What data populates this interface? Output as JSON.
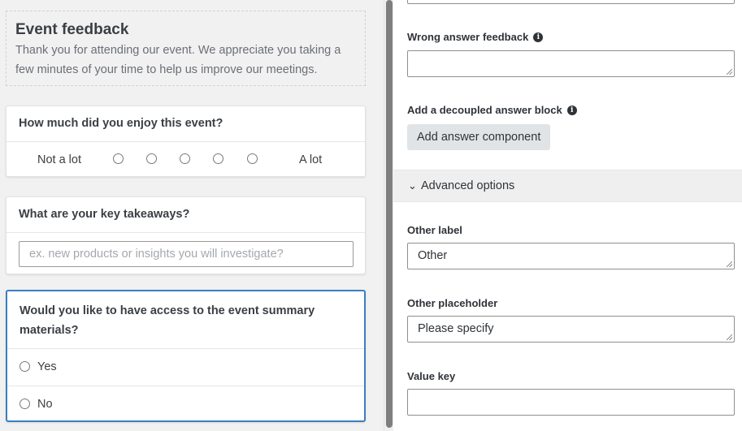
{
  "form": {
    "title": "Event feedback",
    "description": "Thank you for attending our event. We appreciate you taking a few minutes of your time to help us improve our meetings.",
    "q1": {
      "label": "How much did you enjoy this event?",
      "low": "Not a lot",
      "high": "A lot"
    },
    "q2": {
      "label": "What are your key takeaways?",
      "placeholder": "ex. new products or insights you will investigate?"
    },
    "q3": {
      "label": "Would you like to have access to the event summary materials?",
      "options": [
        "Yes",
        "No"
      ]
    }
  },
  "settings": {
    "wrong_answer_label": "Wrong answer feedback",
    "wrong_answer_value": "",
    "decoupled_label": "Add a decoupled answer block",
    "add_component_label": "Add answer component",
    "advanced_label": "Advanced options",
    "other_label_label": "Other label",
    "other_label_value": "Other",
    "other_placeholder_label": "Other placeholder",
    "other_placeholder_value": "Please specify",
    "value_key_label": "Value key",
    "value_key_value": ""
  },
  "icons": {
    "info": "info-icon",
    "chevron": "chevron-down-icon",
    "resize": "resize-grip-icon"
  },
  "colors": {
    "accent": "#3b7fc4",
    "panel_bg": "#f1f1f1",
    "button_bg": "#e1e4e7"
  }
}
